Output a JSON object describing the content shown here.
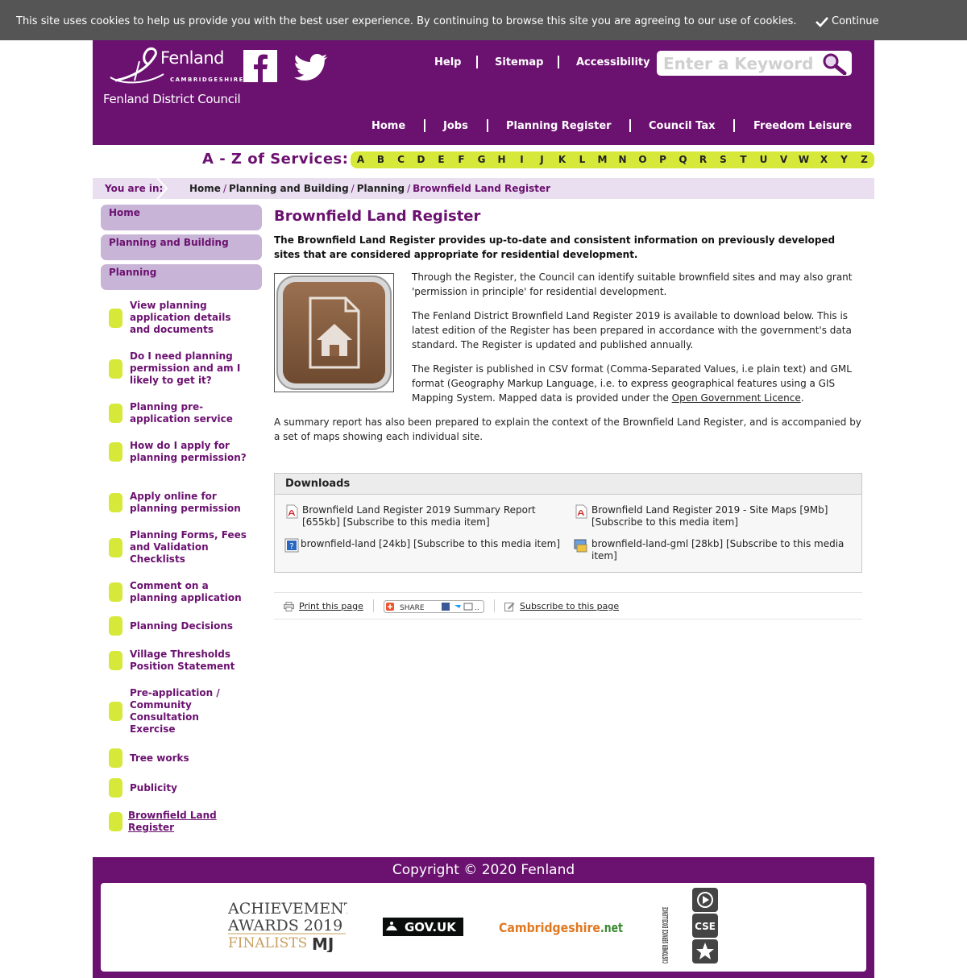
{
  "cookie": {
    "message": "This site uses cookies to help us provide you with the best user experience. By continuing to browse this site you are agreeing to our use of cookies.",
    "continue_label": "Continue"
  },
  "header": {
    "logo_name": "Fenland",
    "logo_county": "CAMBRIDGESHIRE",
    "logo_council": "Fenland District Council",
    "top_links": [
      "Help",
      "Sitemap",
      "Accessibility"
    ],
    "search_placeholder": "Enter a Keyword",
    "main_nav": [
      "Home",
      "Jobs",
      "Planning Register",
      "Council Tax",
      "Freedom Leisure"
    ],
    "brand_color": "#6b1170"
  },
  "az": {
    "label": "A - Z of Services:",
    "letters": [
      "A",
      "B",
      "C",
      "D",
      "E",
      "F",
      "G",
      "H",
      "I",
      "J",
      "K",
      "L",
      "M",
      "N",
      "O",
      "P",
      "Q",
      "R",
      "S",
      "T",
      "U",
      "V",
      "W",
      "X",
      "Y",
      "Z"
    ],
    "accent_color": "#d6e83a"
  },
  "breadcrumb": {
    "you_are_in": "You are in:",
    "items": [
      "Home",
      "Planning and Building",
      "Planning",
      "Brownfield Land Register"
    ]
  },
  "sidebar": {
    "level1": [
      "Home",
      "Planning and Building",
      "Planning"
    ],
    "items": [
      "View planning application details and documents",
      "Do I need planning permission and am I likely to get it?",
      "Planning pre-application service",
      "How do I apply for planning permission?",
      "Apply online for planning permission",
      "Planning Forms, Fees and Validation Checklists",
      "Comment on a planning application",
      "Planning Decisions",
      "Village Thresholds Position Statement",
      "Pre-application / Community Consultation Exercise",
      "Tree works",
      "Publicity",
      "Brownfield Land Register"
    ]
  },
  "content": {
    "title": "Brownfield Land Register",
    "intro": "The Brownfield Land Register provides up-to-date and consistent information on previously developed sites that are considered appropriate for residential development.",
    "p1": "Through the Register, the Council can identify suitable brownfield sites and may also grant 'permission in principle' for residential development.",
    "p2": "The Fenland District Brownfield Land Register 2019 is available to download below. This is latest edition of the Register has been prepared in accordance with the government's data standard. The Register is updated and published annually.",
    "p3_start": "The Register is published in CSV format (Comma-Separated Values, i.e plain text) and GML format (Geography Markup Language, i.e. to express geographical features using a GIS Mapping System. Mapped data is provided under the ",
    "p3_link": "Open Government Licence",
    "p3_end": ".",
    "p4": "A summary report has also been prepared to explain the context of the Brownfield Land Register, and is accompanied by a set of maps showing each individual site."
  },
  "downloads": {
    "heading": "Downloads",
    "items": [
      {
        "text": "Brownfield Land Register 2019 Summary Report [655kb] [Subscribe to this media item]",
        "icon": "pdf-icon"
      },
      {
        "text": "Brownfield Land Register 2019 - Site Maps [9Mb] [Subscribe to this media item]",
        "icon": "pdf-icon"
      },
      {
        "text": "brownfield-land [24kb] [Subscribe to this media item]",
        "icon": "unknown-file-icon"
      },
      {
        "text": "brownfield-land-gml [28kb] [Subscribe to this media item]",
        "icon": "gml-file-icon"
      }
    ]
  },
  "tools": {
    "print": "Print this page",
    "share": "SHARE",
    "subscribe": "Subscribe to this page"
  },
  "footer": {
    "copyright": "Copyright © 2020 Fenland",
    "logos": {
      "awards_line1": "ACHIEVEMENT",
      "awards_line2": "AWARDS 2019",
      "awards_line3": "FINALISTS",
      "awards_mj": "MJ",
      "govuk": "GOV.UK",
      "cambs": "Cambridgeshire",
      "cambs_tld": ".net",
      "cse_vertical": "CUSTOMER SERVICE EXCELLENCE",
      "cse_box": "CSE"
    }
  }
}
